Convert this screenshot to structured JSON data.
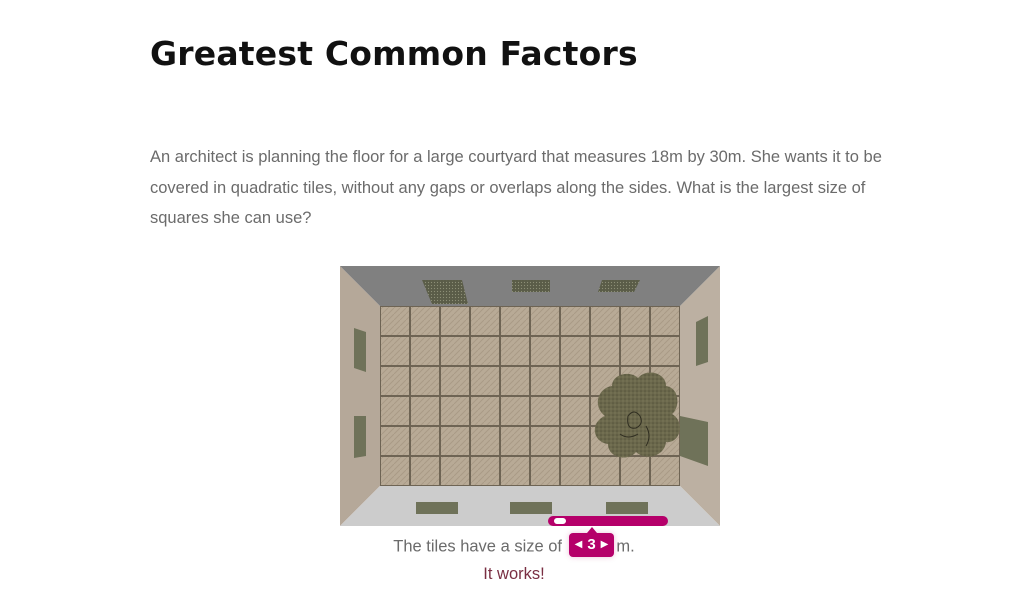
{
  "page": {
    "title": "Greatest Common Factors",
    "problem": "An architect is planning the floor for a large courtyard that measures 18m by 30m. She wants it to be covered in quadratic tiles, without any gaps or overlaps along the sides. What is the largest size of squares she can use?"
  },
  "scene": {
    "courtyard_width_m": 30,
    "courtyard_height_m": 18,
    "tile_size_m": 3,
    "colors": {
      "wall": "#b3a79a",
      "ceiling": "#7f7f7f",
      "floor_front": "#cfcfcf",
      "tile": "#b6a793",
      "grout": "#6e6454",
      "vent": "#6f7259",
      "bush": "#6d6a4e"
    }
  },
  "answer": {
    "prefix": "The tiles have a size of",
    "value": "3",
    "suffix": "m.",
    "slider_level": 0.05
  },
  "feedback": "It works!",
  "icons": {
    "decrease": "triangle-left-icon",
    "increase": "triangle-right-icon"
  }
}
